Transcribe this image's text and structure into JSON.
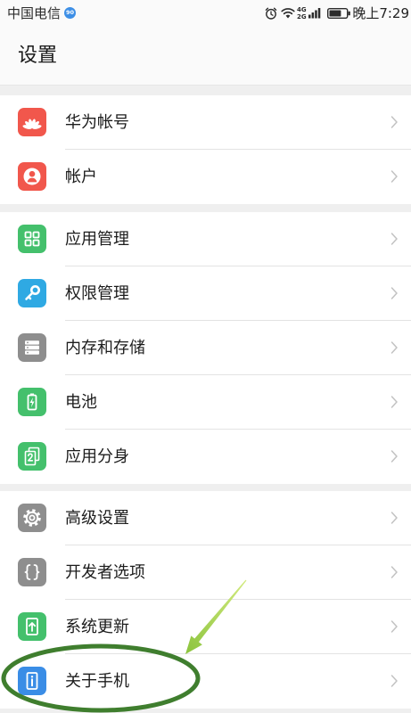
{
  "status_bar": {
    "carrier": "中国电信",
    "badge": "90",
    "badge_color": "#3d8fe6",
    "network_top": "4G",
    "network_bottom": "2G",
    "time": "晚上7:29",
    "battery_level": 0.7,
    "icons": [
      "alarm-icon",
      "wifi-icon",
      "signal-icon",
      "battery-icon"
    ]
  },
  "header": {
    "title": "设置"
  },
  "groups": [
    {
      "items": [
        {
          "label": "华为帐号",
          "icon": "huawei-logo-icon",
          "color": "#f1574c"
        },
        {
          "label": "帐户",
          "icon": "account-icon",
          "color": "#f1574c"
        }
      ]
    },
    {
      "items": [
        {
          "label": "应用管理",
          "icon": "app-grid-icon",
          "color": "#44c06c"
        },
        {
          "label": "权限管理",
          "icon": "key-icon",
          "color": "#2fa9e3"
        },
        {
          "label": "内存和存储",
          "icon": "storage-icon",
          "color": "#8e8e8e"
        },
        {
          "label": "电池",
          "icon": "battery-charging-icon",
          "color": "#44c06c"
        },
        {
          "label": "应用分身",
          "icon": "app-twin-icon",
          "color": "#44c06c"
        }
      ]
    },
    {
      "items": [
        {
          "label": "高级设置",
          "icon": "gear-icon",
          "color": "#8e8e8e"
        },
        {
          "label": "开发者选项",
          "icon": "braces-icon",
          "color": "#8e8e8e"
        },
        {
          "label": "系统更新",
          "icon": "system-update-icon",
          "color": "#44c06c"
        },
        {
          "label": "关于手机",
          "icon": "phone-info-icon",
          "color": "#3a8de6"
        }
      ]
    }
  ],
  "annotations": {
    "ellipse_color": "#3f7e2e",
    "arrow_color_start": "#d2ea7e",
    "arrow_color_end": "#8cc43e"
  }
}
